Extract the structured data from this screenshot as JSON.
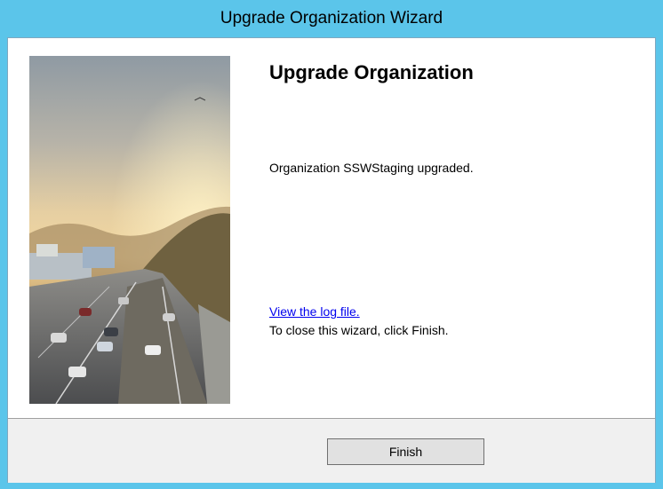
{
  "window": {
    "title": "Upgrade Organization Wizard"
  },
  "page": {
    "heading": "Upgrade Organization",
    "message": "Organization SSWStaging upgraded.",
    "log_link": "View the log file.",
    "close_hint": "To close this wizard, click Finish."
  },
  "footer": {
    "finish_label": "Finish"
  },
  "colors": {
    "window_frame": "#5bc5ea",
    "content_bg": "#ffffff",
    "footer_bg": "#f0f0f0",
    "link": "#0000ee"
  }
}
